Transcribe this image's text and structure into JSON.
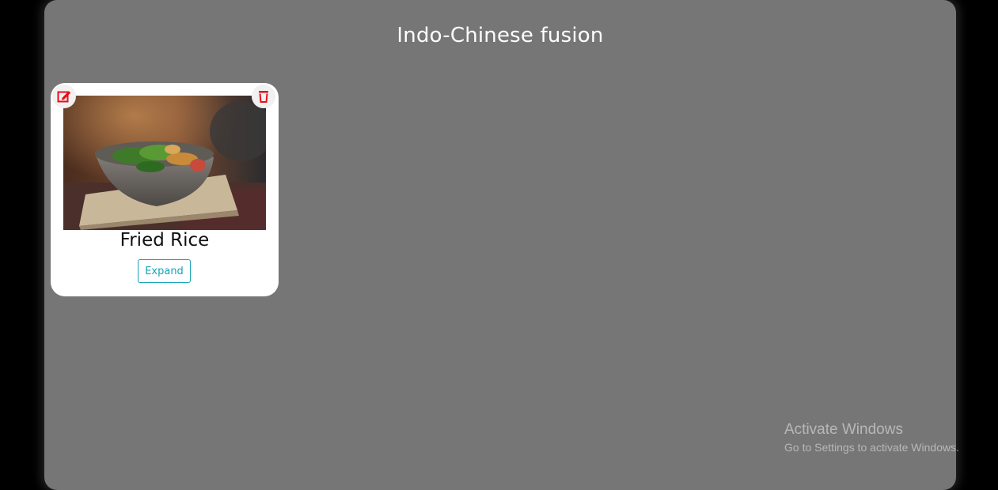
{
  "page": {
    "title": "Indo-Chinese fusion"
  },
  "card": {
    "name": "Fried Rice",
    "expand_label": "Expand",
    "image_icon": "food-photo-bowl",
    "edit_icon": "pencil-square-icon",
    "delete_icon": "trash-icon"
  },
  "watermark": {
    "title": "Activate Windows",
    "subtitle": "Go to Settings to activate Windows."
  },
  "colors": {
    "background": "#000000",
    "panel": "#767676",
    "card": "#ffffff",
    "accent": "#17a2b8",
    "icon_red": "#e8101a"
  }
}
